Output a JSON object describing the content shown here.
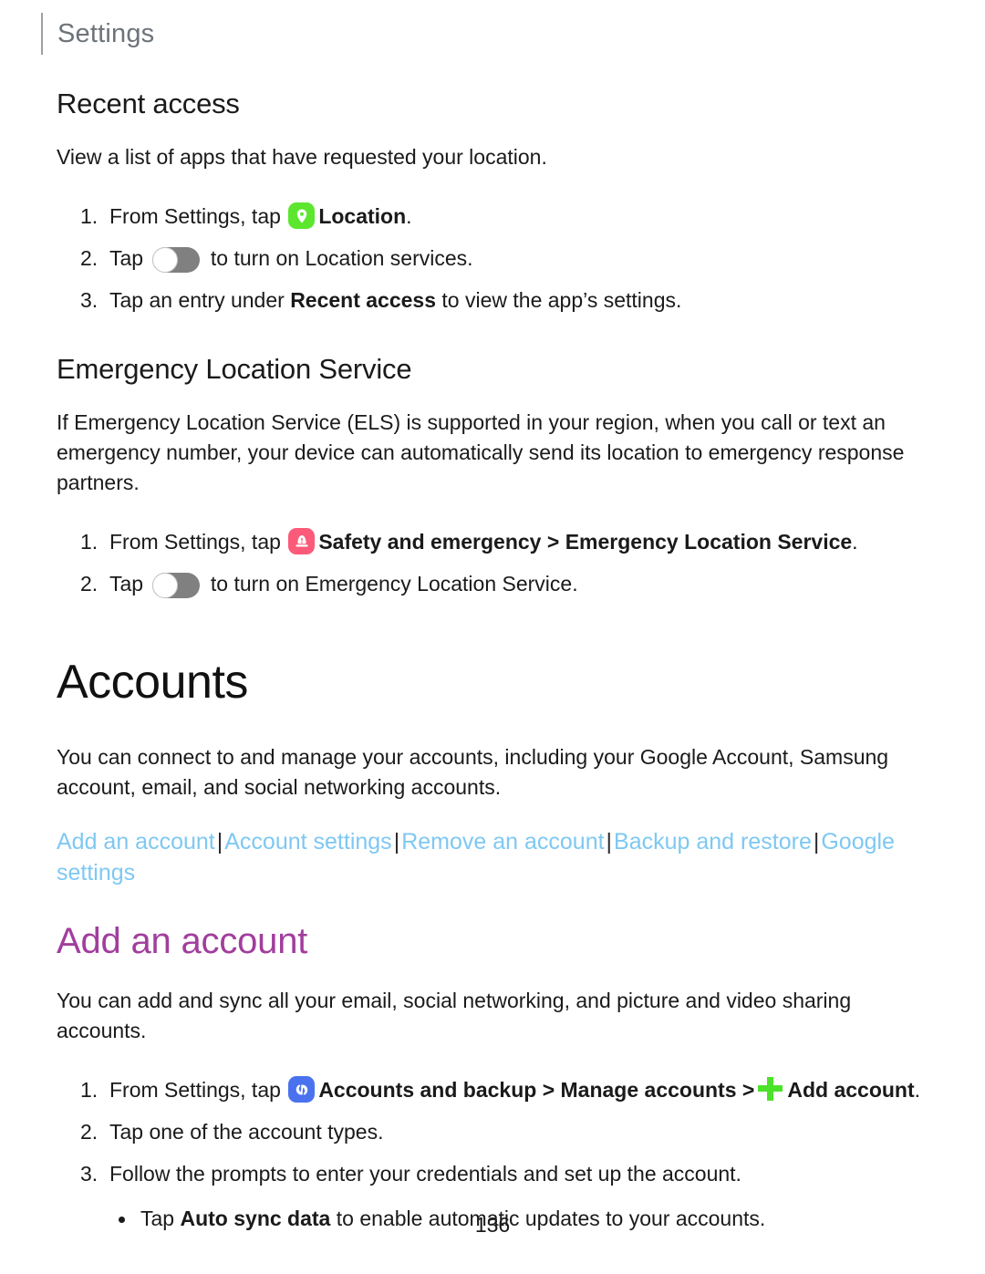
{
  "header": {
    "label": "Settings"
  },
  "sections": {
    "recent_access": {
      "heading": "Recent access",
      "intro": "View a list of apps that have requested your location.",
      "steps": [
        {
          "num": "1.",
          "pre": "From Settings, tap ",
          "icon": "location-icon",
          "bold": "Location",
          "post": "."
        },
        {
          "num": "2.",
          "pre": "Tap ",
          "icon": "toggle-switch",
          "post": " to turn on Location services."
        },
        {
          "num": "3.",
          "pre": "Tap an entry under ",
          "bold": "Recent access",
          "post": " to view the app’s settings."
        }
      ]
    },
    "emergency_location_service": {
      "heading": "Emergency Location Service",
      "intro": "If Emergency Location Service (ELS) is supported in your region, when you call or text an emergency number, your device can automatically send its location to emergency response partners.",
      "steps": [
        {
          "num": "1.",
          "pre": "From Settings, tap ",
          "icon": "safety-and-emergency-icon",
          "bold": "Safety and emergency",
          "chevron": ">",
          "bold2": "Emergency Location Service",
          "post": "."
        },
        {
          "num": "2.",
          "pre": "Tap ",
          "icon": "toggle-switch",
          "post": " to turn on Emergency Location Service."
        }
      ]
    },
    "accounts": {
      "chapter_title": "Accounts",
      "intro": "You can connect to and manage your accounts, including your Google Account, Samsung account, email, and social networking accounts.",
      "links": [
        "Add an account",
        "Account settings",
        "Remove an account",
        "Backup and restore",
        "Google settings"
      ],
      "link_separator": "|"
    },
    "add_an_account": {
      "heading": "Add an account",
      "intro": "You can add and sync all your email, social networking, and picture and video sharing accounts.",
      "steps": [
        {
          "num": "1.",
          "pre": "From Settings, tap ",
          "icon": "accounts-and-backup-icon",
          "bold": "Accounts and backup",
          "chevron": ">",
          "bold2": "Manage accounts",
          "chevron2": ">",
          "plus_icon": "add-plus-icon",
          "bold3": "Add account",
          "post": "."
        },
        {
          "num": "2.",
          "pre": "Tap one of the account types."
        },
        {
          "num": "3.",
          "pre": "Follow the prompts to enter your credentials and set up the account.",
          "subbullets": [
            {
              "pre": "Tap ",
              "bold": "Auto sync data",
              "post": " to enable automatic updates to your accounts."
            }
          ]
        }
      ]
    }
  },
  "footer": {
    "page_number": "136"
  },
  "colors": {
    "header_rule": "#9aa0a6",
    "header_text": "#6d7379",
    "topic_heading": "#a13e9d",
    "link": "#7ec8f2",
    "location_icon_bg": "#5ce62e",
    "safety_icon_bg": "#fb5a78",
    "accounts_icon_bg": "#4a72ef",
    "plus_icon": "#4ce22a",
    "toggle_track": "#808080"
  }
}
